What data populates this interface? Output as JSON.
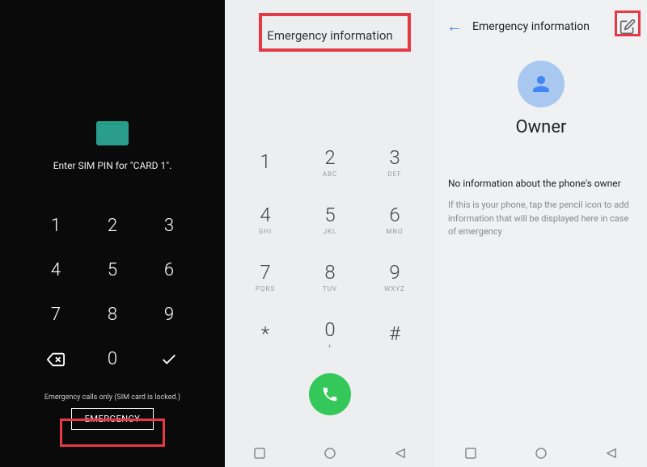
{
  "p1": {
    "prompt": "Enter SIM PIN for \"CARD 1\".",
    "keys": [
      "1",
      "2",
      "3",
      "4",
      "5",
      "6",
      "7",
      "8",
      "9"
    ],
    "zero": "0",
    "status": "Emergency calls only (SIM card is locked.)",
    "emergency": "EMERGENCY"
  },
  "p2": {
    "header": "Emergency information",
    "keys": [
      {
        "n": "1",
        "s": ""
      },
      {
        "n": "2",
        "s": "ABC"
      },
      {
        "n": "3",
        "s": "DEF"
      },
      {
        "n": "4",
        "s": "GHI"
      },
      {
        "n": "5",
        "s": "JKL"
      },
      {
        "n": "6",
        "s": "MNO"
      },
      {
        "n": "7",
        "s": "PQRS"
      },
      {
        "n": "8",
        "s": "TUV"
      },
      {
        "n": "9",
        "s": "WXYZ"
      },
      {
        "n": "*",
        "s": ""
      },
      {
        "n": "0",
        "s": "+"
      },
      {
        "n": "#",
        "s": ""
      }
    ]
  },
  "p3": {
    "title": "Emergency information",
    "owner": "Owner",
    "noinfo": "No information about the phone's owner",
    "hint": "If this is your phone, tap the pencil icon to add information that will be displayed here in case of emergency"
  }
}
